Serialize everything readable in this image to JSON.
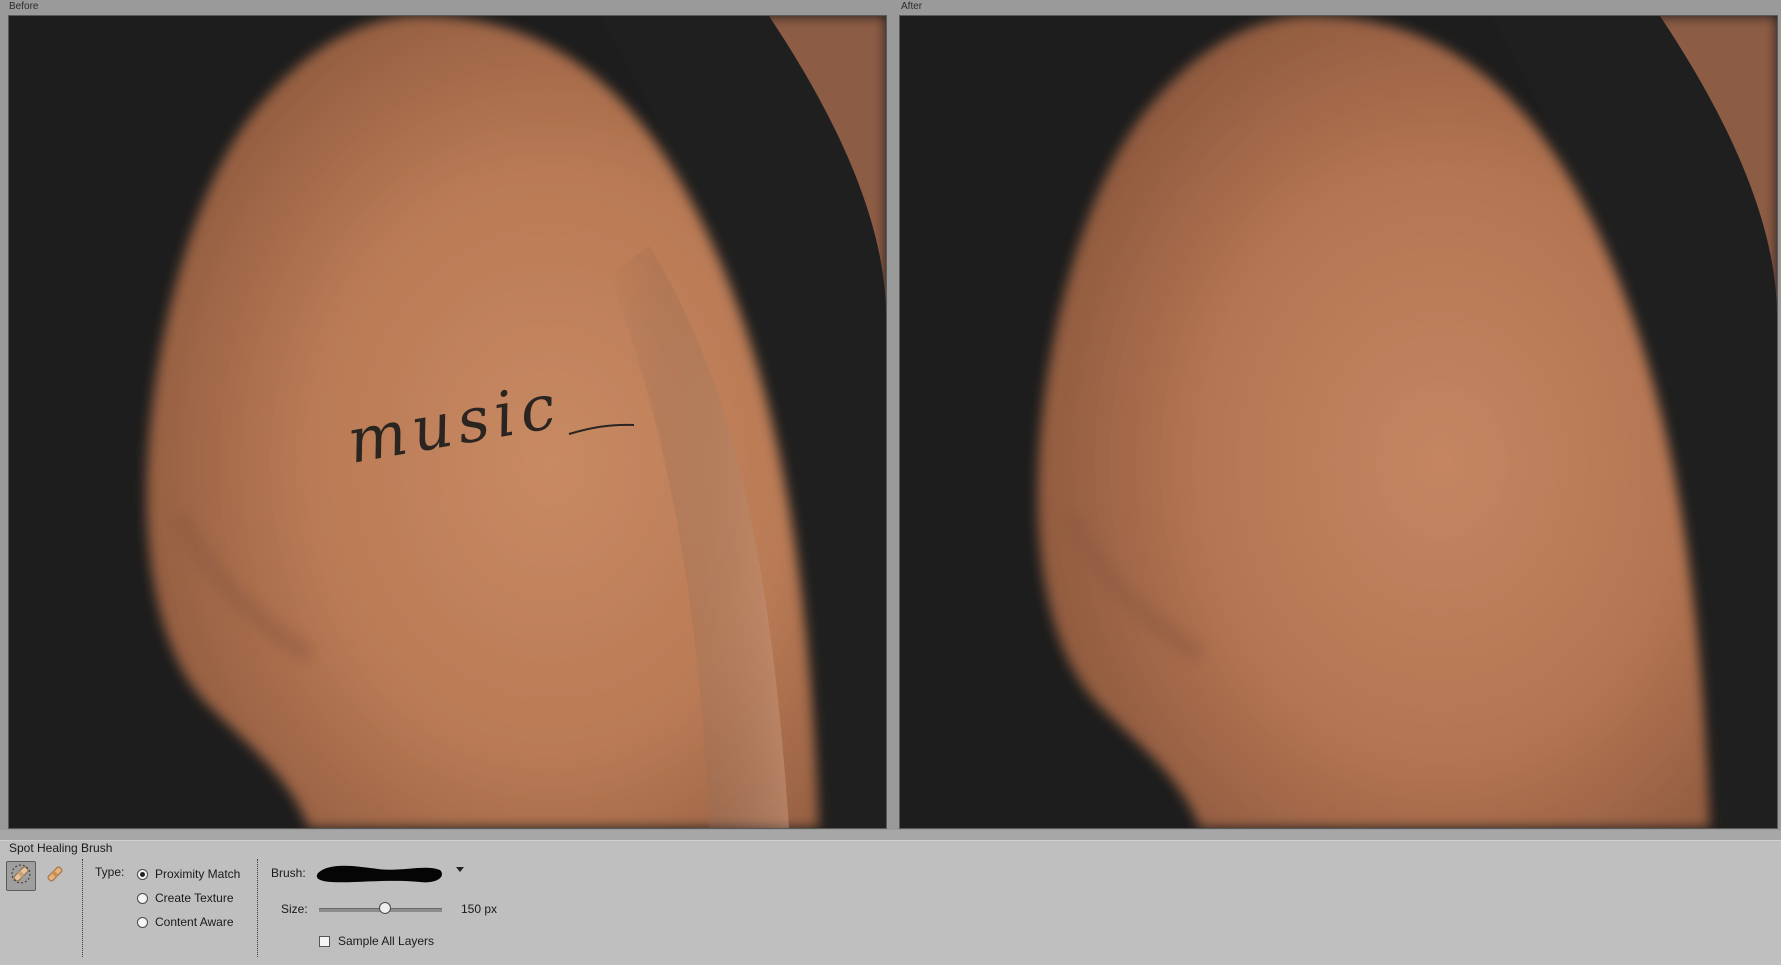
{
  "panels": {
    "before_label": "Before",
    "after_label": "After",
    "before_tattoo_text": "music"
  },
  "options_bar": {
    "tool_name": "Spot Healing Brush",
    "type_label": "Type:",
    "type_options": [
      {
        "label": "Proximity Match",
        "selected": true
      },
      {
        "label": "Create Texture",
        "selected": false
      },
      {
        "label": "Content Aware",
        "selected": false
      }
    ],
    "brush_label": "Brush:",
    "size_label": "Size:",
    "size_value": "150 px",
    "size_fraction": 0.54,
    "sample_all_layers_label": "Sample All Layers",
    "sample_all_layers_checked": false,
    "icons": {
      "active_tool": "spot-healing-brush-icon",
      "alt_tool": "healing-brush-icon",
      "brush_dropdown": "chevron-down-icon"
    }
  },
  "colors": {
    "background": "#1e1e1e",
    "skin_light": "#c98a62",
    "skin_mid": "#b0714c",
    "skin_dark": "#7a4a32",
    "tattoo_ink": "#2b2522"
  }
}
